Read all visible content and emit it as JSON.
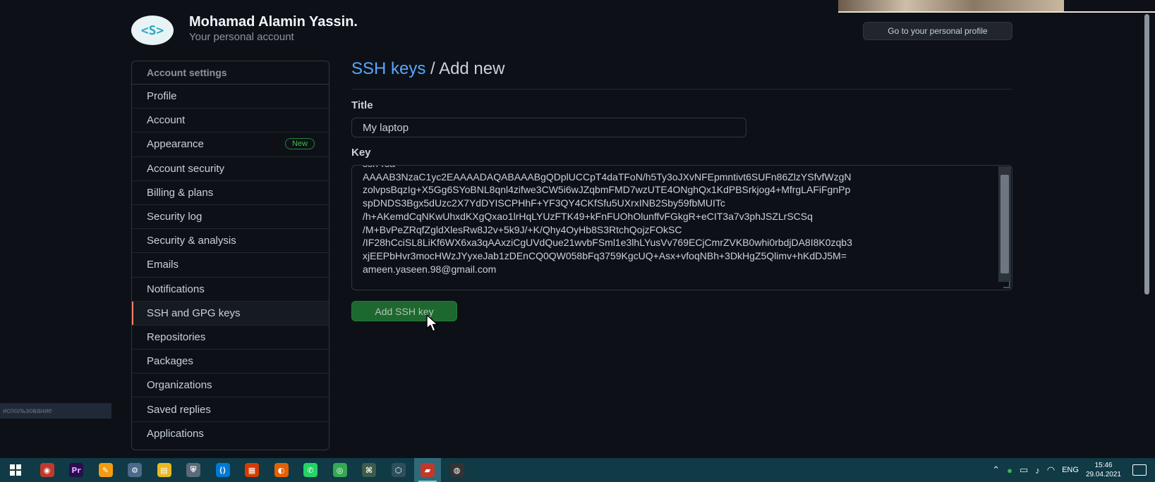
{
  "user": {
    "avatar_text": "<S>",
    "name": "Mohamad Alamin Yassin.",
    "subtitle": "Your personal account",
    "profile_button": "Go to your personal profile"
  },
  "sidebar": {
    "header": "Account settings",
    "items": [
      {
        "label": "Profile"
      },
      {
        "label": "Account"
      },
      {
        "label": "Appearance",
        "badge": "New"
      },
      {
        "label": "Account security"
      },
      {
        "label": "Billing & plans"
      },
      {
        "label": "Security log"
      },
      {
        "label": "Security & analysis"
      },
      {
        "label": "Emails"
      },
      {
        "label": "Notifications"
      },
      {
        "label": "SSH and GPG keys",
        "selected": true
      },
      {
        "label": "Repositories"
      },
      {
        "label": "Packages"
      },
      {
        "label": "Organizations"
      },
      {
        "label": "Saved replies"
      },
      {
        "label": "Applications"
      }
    ]
  },
  "main": {
    "breadcrumb_link": "SSH keys",
    "breadcrumb_separator": " / ",
    "breadcrumb_current": "Add new",
    "title_label": "Title",
    "title_value": "My laptop",
    "key_label": "Key",
    "key_value": "ssh-rsa\nAAAAB3NzaC1yc2EAAAADAQABAAABgQDplUCCpT4daTFoN/h5Ty3oJXvNFEpmntivt6SUFn86ZlzYSfvfWzgN\nzolvpsBqzIg+X5Gg6SYoBNL8qnl4zifwe3CW5i6wJZqbmFMD7wzUTE4ONghQx1KdPBSrkjog4+MfrgLAFiFgnPp\nspDNDS3Bgx5dUzc2X7YdDYISCPHhF+YF3QY4CKfSfu5UXrxINB2Sby59fbMUITc\n/h+AKemdCqNKwUhxdKXgQxao1lrHqLYUzFTK49+kFnFUOhOlunffvFGkgR+eCIT3a7v3phJSZLrSCSq\n/M+BvPeZRqfZgldXlesRw8J2v+5k9J/+K/Qhy4OyHb8S3RtchQojzFOkSC\n/IF28hCciSL8LiKf6WX6xa3qAAxziCgUVdQue21wvbFSml1e3lhLYusVv769ECjCmrZVKB0whi0rbdjDA8I8K0zqb3\nxjEEPbHvr3mocHWzJYyxeJab1zDEnCQ0QW058bFq3759KgcUQ+Asx+vfoqNBh+3DkHgZ5Qlimv+hKdDJ5M=\nameen.yaseen.98@gmail.com",
    "submit_button": "Add SSH key"
  },
  "overlay": {
    "tooltip_text": "использование"
  },
  "taskbar": {
    "apps": [
      {
        "name": "chrome-alt",
        "glyph": "◉",
        "color": "#c0392b"
      },
      {
        "name": "premiere",
        "glyph": "Pr",
        "color": "#2a0d4a",
        "fg": "#d6a7ff"
      },
      {
        "name": "pencil-app",
        "glyph": "✎",
        "color": "#f39c12"
      },
      {
        "name": "car-app",
        "glyph": "⚙",
        "color": "#4b6b8a"
      },
      {
        "name": "file-explorer",
        "glyph": "▤",
        "color": "#e8b923"
      },
      {
        "name": "vpn-app",
        "glyph": "⛨",
        "color": "#5a6a78"
      },
      {
        "name": "vscode",
        "glyph": "⟨⟩",
        "color": "#0078d4"
      },
      {
        "name": "office",
        "glyph": "▦",
        "color": "#d83b01"
      },
      {
        "name": "firefox",
        "glyph": "◐",
        "color": "#e66000"
      },
      {
        "name": "whatsapp",
        "glyph": "✆",
        "color": "#25d366"
      },
      {
        "name": "chrome",
        "glyph": "◎",
        "color": "#34a853"
      },
      {
        "name": "terminal-app",
        "glyph": "⌘",
        "color": "#3c5b4a"
      },
      {
        "name": "box-app",
        "glyph": "⬡",
        "color": "#2f4f5f"
      },
      {
        "name": "active-app",
        "glyph": "▰",
        "color": "#c0392b",
        "active": true
      },
      {
        "name": "obs",
        "glyph": "◍",
        "color": "#333333"
      }
    ],
    "tray": {
      "language": "ENG",
      "time": "15:46",
      "date": "29.04.2021"
    }
  }
}
